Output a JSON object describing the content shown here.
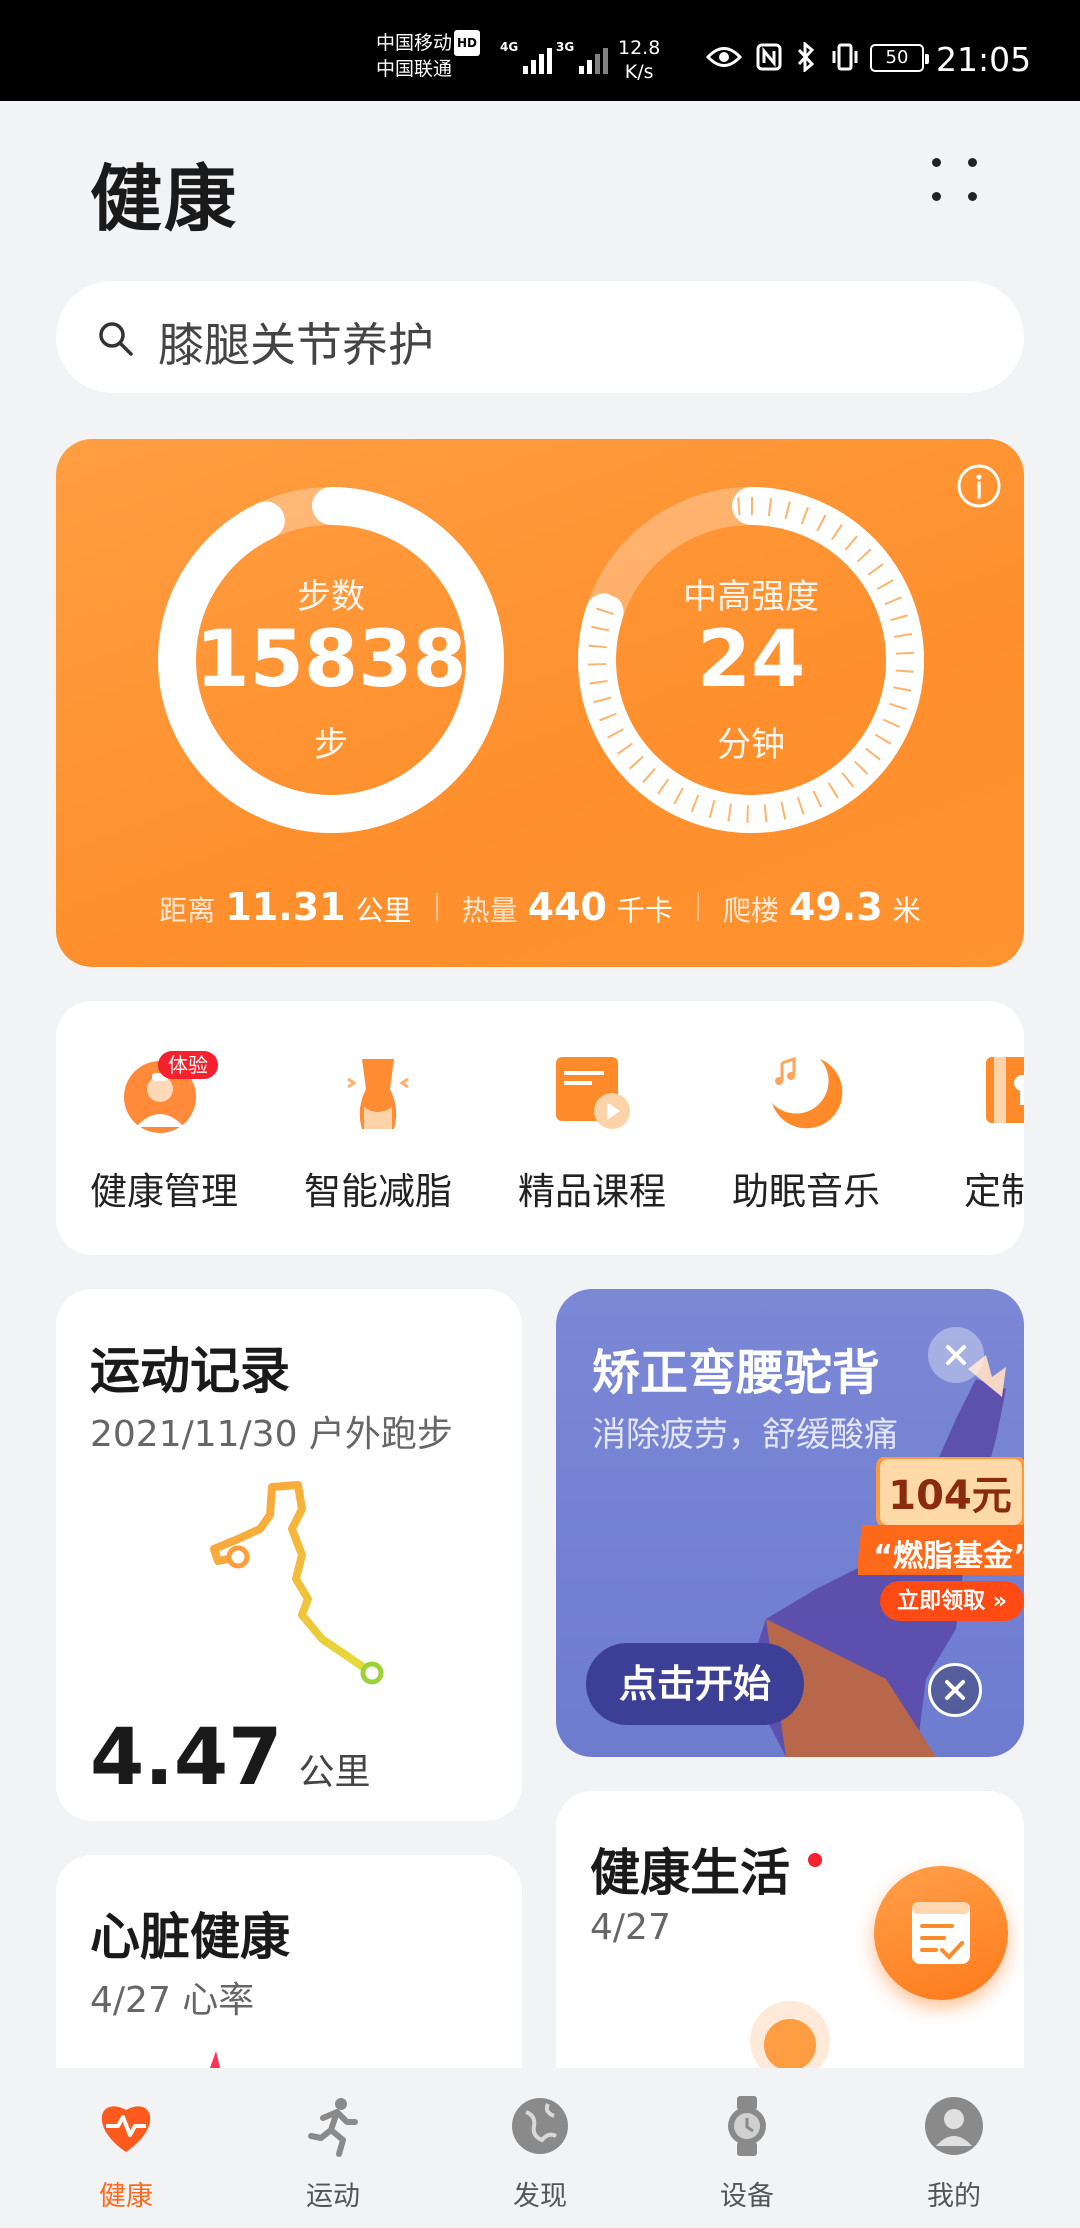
{
  "status_bar": {
    "carrier1": "中国移动",
    "carrier1_badge": "HD",
    "carrier2": "中国联通",
    "net1": "4G",
    "net2": "3G",
    "speed_value": "12.8",
    "speed_unit": "K/s",
    "battery": "50",
    "time": "21:05"
  },
  "header": {
    "title": "健康"
  },
  "search": {
    "text": "膝腿关节养护"
  },
  "activity": {
    "steps_label": "步数",
    "steps_value": "15838",
    "steps_unit": "步",
    "steps_progress": 0.93,
    "intensity_label": "中高强度",
    "intensity_value": "24",
    "intensity_unit": "分钟",
    "intensity_progress": 0.8,
    "stats": [
      {
        "label": "距离",
        "value": "11.31",
        "unit": "公里"
      },
      {
        "label": "热量",
        "value": "440",
        "unit": "千卡"
      },
      {
        "label": "爬楼",
        "value": "49.3",
        "unit": "米"
      }
    ],
    "accent": "#ff9a3c"
  },
  "services": [
    {
      "label": "健康管理",
      "badge": "体验",
      "icon": "doctor-icon"
    },
    {
      "label": "智能减脂",
      "icon": "waist-icon"
    },
    {
      "label": "精品课程",
      "icon": "video-course-icon"
    },
    {
      "label": "助眠音乐",
      "icon": "moon-music-icon"
    },
    {
      "label": "定制",
      "icon": "custom-plan-icon"
    }
  ],
  "exercise_card": {
    "title": "运动记录",
    "subtitle": "2021/11/30 户外跑步",
    "distance": "4.47",
    "distance_unit": "公里"
  },
  "banner": {
    "title": "矫正弯腰驼背",
    "subtitle": "消除疲劳，舒缓酸痛",
    "button": "点击开始",
    "coupon_amount": "104元",
    "coupon_name": "“燃脂基金”",
    "coupon_claim": "立即领取 »",
    "background": "#7483d2"
  },
  "heart_card": {
    "title": "心脏健康",
    "subtitle": "4/27 心率"
  },
  "life_card": {
    "title": "健康生活",
    "subtitle": "4/27"
  },
  "bottom_nav": [
    {
      "label": "健康",
      "icon": "heart-pulse-icon",
      "active": true
    },
    {
      "label": "运动",
      "icon": "runner-icon",
      "active": false
    },
    {
      "label": "发现",
      "icon": "globe-icon",
      "active": false
    },
    {
      "label": "设备",
      "icon": "watch-icon",
      "active": false
    },
    {
      "label": "我的",
      "icon": "person-icon",
      "active": false
    }
  ]
}
